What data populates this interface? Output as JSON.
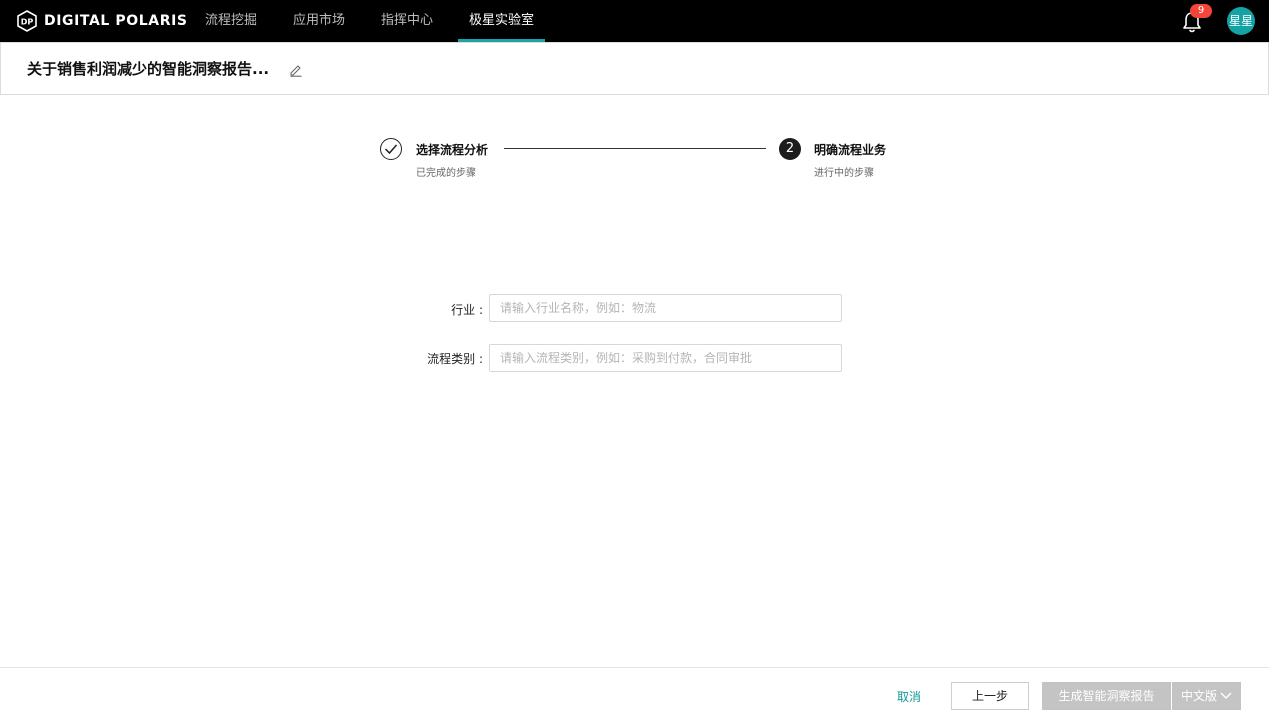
{
  "app": {
    "logo_text": "DIGITAL POLARIS",
    "logo_mark": "DP"
  },
  "nav": {
    "items": [
      {
        "label": "流程挖掘",
        "active": false
      },
      {
        "label": "应用市场",
        "active": false
      },
      {
        "label": "指挥中心",
        "active": false
      },
      {
        "label": "极星实验室",
        "active": true
      }
    ],
    "notification_count": "9",
    "avatar_text": "星星"
  },
  "page": {
    "title": "关于销售利润减少的智能洞察报告..."
  },
  "steps": [
    {
      "title": "选择流程分析",
      "subtitle": "已完成的步骤",
      "status": "done"
    },
    {
      "number": "2",
      "title": "明确流程业务",
      "subtitle": "进行中的步骤",
      "status": "active"
    }
  ],
  "form": {
    "industry": {
      "label": "行业 :",
      "value": "",
      "placeholder": "请输入行业名称，例如：物流"
    },
    "process_type": {
      "label": "流程类别 :",
      "value": "",
      "placeholder": "请输入流程类别，例如：采购到付款，合同审批"
    }
  },
  "footer": {
    "cancel_label": "取消",
    "prev_label": "上一步",
    "generate_label": "生成智能洞察报告",
    "language_label": "中文版"
  },
  "colors": {
    "accent": "#19a4a6",
    "badge": "#f5443a",
    "disabled_button": "#c4c4c4"
  }
}
